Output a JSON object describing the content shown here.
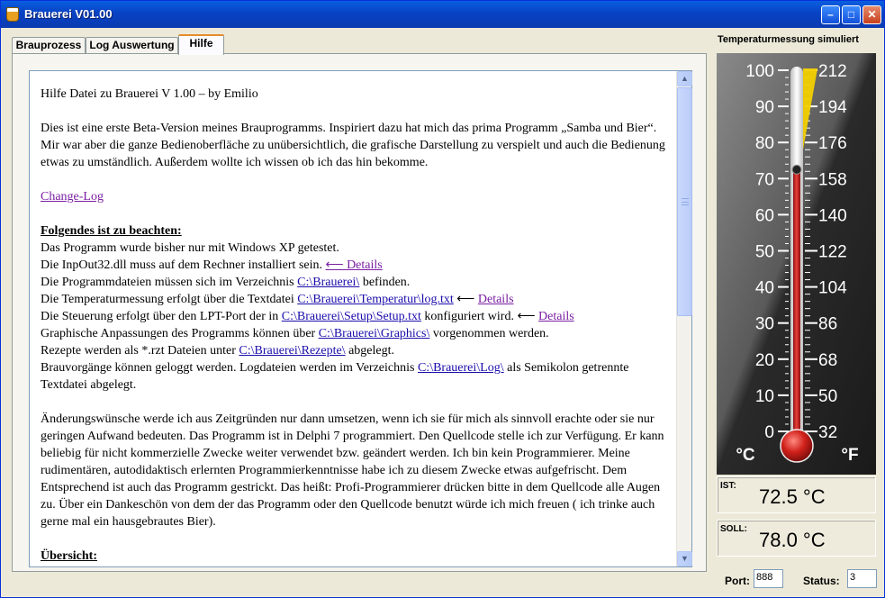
{
  "window": {
    "title": "Brauerei V01.00"
  },
  "tabs": [
    {
      "label": "Brauprozess"
    },
    {
      "label": "Log Auswertung"
    },
    {
      "label": "Hilfe"
    }
  ],
  "help": {
    "heading": "Hilfe Datei zu Brauerei V 1.00 – by Emilio",
    "intro": "Dies ist eine erste Beta-Version meines Brauprogramms. Inspiriert dazu hat mich das prima Programm „Samba und Bier“. Mir war aber die ganze Bedienoberfläche zu unübersichtlich, die grafische Darstellung zu verspielt und auch die Bedienung etwas zu umständlich. Außerdem wollte ich wissen ob ich das hin bekomme.",
    "changelog_link": "Change-Log",
    "notes_heading": "Folgendes ist zu beachten:",
    "l1": "Das Programm wurde bisher nur mit Windows XP getestet.",
    "l2": "Die InpOut32.dll muss auf dem Rechner installiert sein.",
    "l2_link": "⟵ Details",
    "l3a": "Die Programmdateien müssen sich im Verzeichnis",
    "l3_link": "C:\\Brauerei\\",
    "l3b": "befinden.",
    "l4a": "Die Temperaturmessung erfolgt über die Textdatei",
    "l4_link": "C:\\Brauerei\\Temperatur\\log.txt",
    "l4_arrow": "⟵",
    "l4_details": "Details",
    "l5a": "Die Steuerung erfolgt über den LPT-Port der in",
    "l5_link": "C:\\Brauerei\\Setup\\Setup.txt",
    "l5b": "konfiguriert wird. ⟵",
    "l5_details": "Details",
    "l6a": "Graphische Anpassungen des Programms können über",
    "l6_link": "C:\\Brauerei\\Graphics\\",
    "l6b": "vorgenommen werden.",
    "l7a": "Rezepte werden als *.rzt Dateien unter",
    "l7_link": "C:\\Brauerei\\Rezepte\\",
    "l7b": "abgelegt.",
    "l8a": "Brauvorgänge können geloggt werden. Logdateien werden im Verzeichnis",
    "l8_link": "C:\\Brauerei\\Log\\",
    "l8b": "als Semikolon getrennte Textdatei abgelegt.",
    "para2": "Änderungswünsche werde ich aus Zeitgründen nur dann umsetzen, wenn ich sie für mich als sinnvoll erachte oder sie nur geringen Aufwand bedeuten. Das Programm ist in Delphi 7 programmiert. Den Quellcode stelle ich zur Verfügung. Er kann beliebig für nicht kommerzielle Zwecke weiter verwendet bzw. geändert werden. Ich bin kein Programmierer. Meine rudimentären, autodidaktisch erlernten Programmierkenntnisse habe ich zu diesem Zwecke etwas aufgefrischt. Dem Entsprechend ist auch das Programm gestrickt. Das heißt: Profi-Programmierer drücken bitte in dem Quellcode alle Augen zu. Über ein Dankeschön von dem der das Programm oder den Quellcode benutzt würde ich mich freuen ( ich trinke auch gerne mal ein hausgebrautes Bier).",
    "overview_heading": "Übersicht:"
  },
  "thermometer": {
    "label": "Temperaturmessung simuliert",
    "celsius_ticks": [
      "100",
      "90",
      "80",
      "70",
      "60",
      "50",
      "40",
      "30",
      "20",
      "10",
      "0"
    ],
    "fahrenheit_ticks": [
      "212",
      "194",
      "176",
      "158",
      "140",
      "122",
      "104",
      "86",
      "68",
      "50",
      "32"
    ],
    "unit_c": "°C",
    "unit_f": "°F",
    "current_celsius": 72.5,
    "setpoint_celsius": 78.0,
    "colors": {
      "mercury": "#D0201A",
      "setpoint_marker": "#F2D000"
    }
  },
  "ist": {
    "label": "IST:",
    "value": "72.5 °C"
  },
  "soll": {
    "label": "SOLL:",
    "value": "78.0 °C"
  },
  "port": {
    "label": "Port:",
    "value": "888"
  },
  "status": {
    "label": "Status:",
    "value": "3"
  }
}
